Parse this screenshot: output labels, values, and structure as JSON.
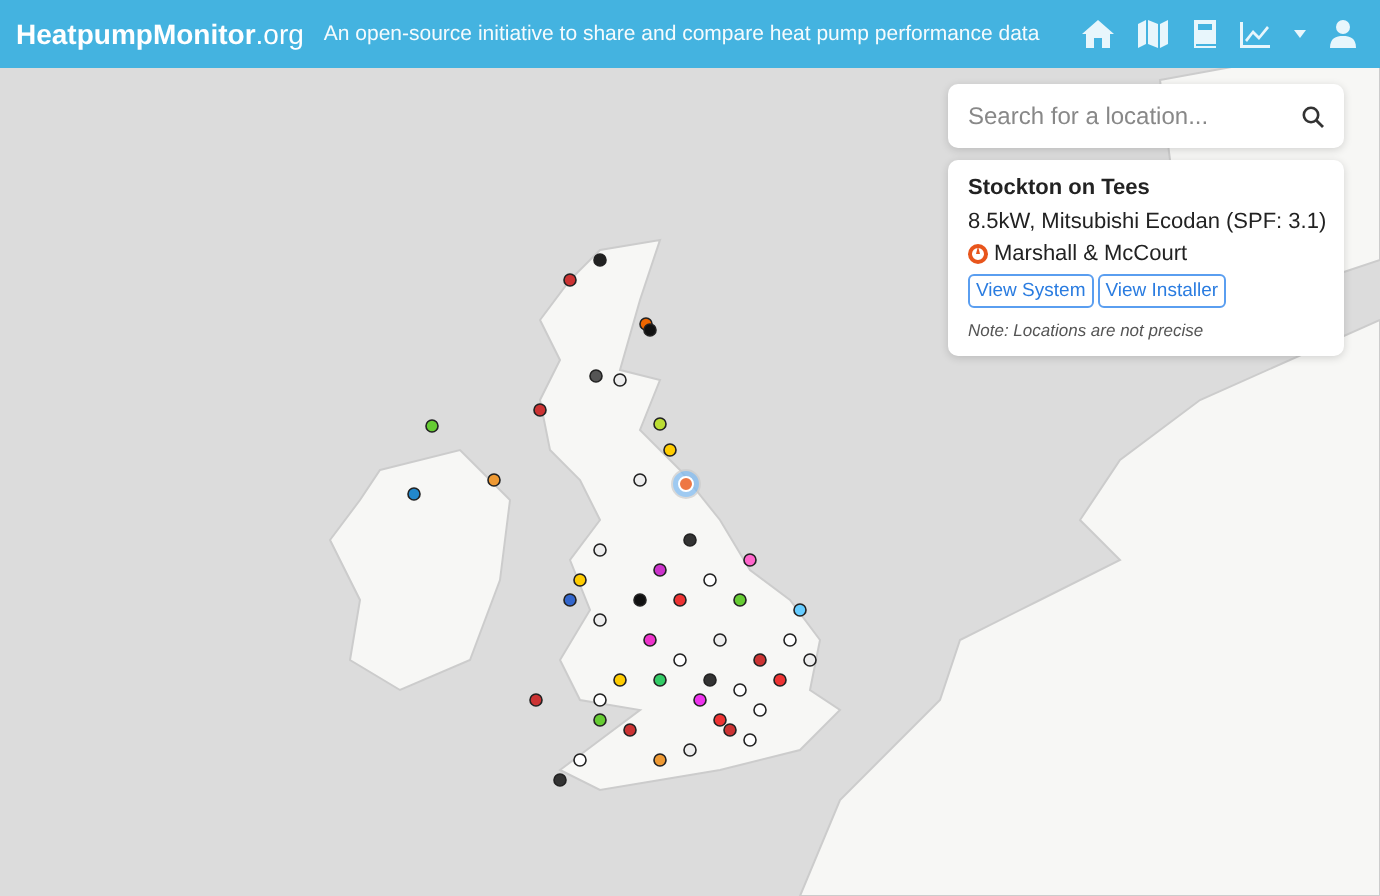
{
  "header": {
    "brand": "HeatpumpMonitor",
    "brand_suffix": ".org",
    "tagline": "An open-source initiative to share and compare heat pump performance data"
  },
  "search": {
    "placeholder": "Search for a location..."
  },
  "location": {
    "title": "Stockton on Tees",
    "system": "8.5kW, Mitsubishi Ecodan (SPF: 3.1)",
    "installer": "Marshall & McCourt",
    "buttons": [
      "View System",
      "View Installer"
    ],
    "note": "Note: Locations are not precise"
  }
}
